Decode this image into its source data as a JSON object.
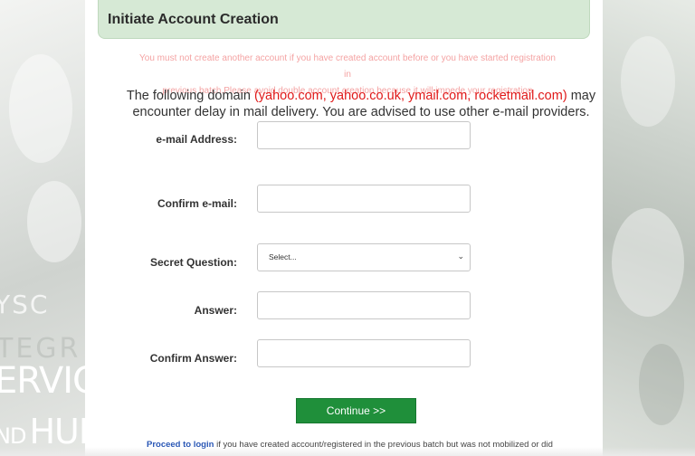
{
  "header": {
    "title": "Initiate Account Creation"
  },
  "warning": {
    "line1": "You must not create another account if you have created account before or you have started registration in",
    "line2": "previous batch.Please avoid double account creation because it will impede your registration"
  },
  "domain_note": {
    "prefix": "The following domain",
    "domains": "(yahoo.com, yahoo.co.uk, ymail.com, rocketmail.com)",
    "suffix": "may encounter delay in mail delivery. You are advised to use other e-mail providers."
  },
  "form": {
    "email_label": "e-mail Address:",
    "email_value": "",
    "confirm_email_label": "Confirm e-mail:",
    "confirm_email_value": "",
    "secret_question_label": "Secret Question:",
    "secret_question_selected": "Select...",
    "answer_label": "Answer:",
    "answer_value": "",
    "confirm_answer_label": "Confirm Answer:",
    "confirm_answer_value": "",
    "continue_label": "Continue >>"
  },
  "footer": {
    "link": "Proceed to login",
    "text": "if you have created account/registered in the previous batch but was not mobilized or did"
  },
  "background": {
    "wm_nysc": "YSC",
    "wm_integrity": "TEGR",
    "wm_service": "ERVICE",
    "wm_and": "ND",
    "wm_hum": "HUM"
  },
  "colors": {
    "header_bg": "#d6e9d5",
    "warning_text": "#f4a3a3",
    "domain_red": "#e01818",
    "button_green": "#1f8f3a",
    "link_blue": "#2a57b5"
  }
}
